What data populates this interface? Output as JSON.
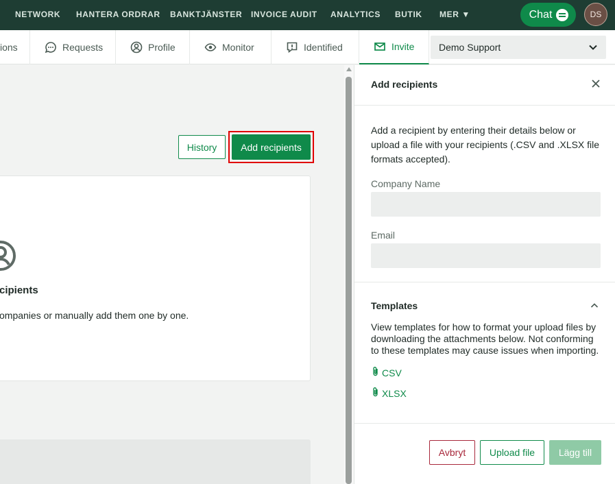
{
  "topnav": {
    "items": [
      "NETWORK",
      "HANTERA ORDRAR",
      "BANKTJÄNSTER",
      "INVOICE AUDIT",
      "ANALYTICS",
      "BUTIK"
    ],
    "more_label": "MER ▼",
    "chat_label": "Chat",
    "avatar_initials": "DS"
  },
  "subnav": {
    "tabs": [
      {
        "label": "ions",
        "icon": "none"
      },
      {
        "label": "Requests",
        "icon": "chat-dots-icon"
      },
      {
        "label": "Profile",
        "icon": "user-circle-icon"
      },
      {
        "label": "Monitor",
        "icon": "eye-icon"
      },
      {
        "label": "Identified",
        "icon": "alert-square-icon"
      },
      {
        "label": "Invite",
        "icon": "envelope-icon",
        "active": true
      }
    ],
    "select_value": "Demo Support"
  },
  "main": {
    "history_label": "History",
    "add_recipients_label": "Add recipients",
    "empty_title": "cipients",
    "empty_desc": "ompanies or manually add them one by one."
  },
  "panel": {
    "title": "Add recipients",
    "description": "Add a recipient by entering their details below or upload a file with your recipients (.CSV and .XLSX file formats accepted).",
    "company_label": "Company Name",
    "company_value": "",
    "email_label": "Email",
    "email_value": "",
    "templates_title": "Templates",
    "templates_desc": "View templates for how to format your upload files by downloading the attachments below. Not conforming to these templates may cause issues when importing.",
    "csv_label": "CSV",
    "xlsx_label": "XLSX",
    "cancel_label": "Avbryt",
    "upload_label": "Upload file",
    "add_label": "Lägg till"
  },
  "colors": {
    "brand_green": "#0f8a4a",
    "topnav_bg": "#1e3d33",
    "danger": "#a8283b",
    "highlight": "#e00000"
  }
}
